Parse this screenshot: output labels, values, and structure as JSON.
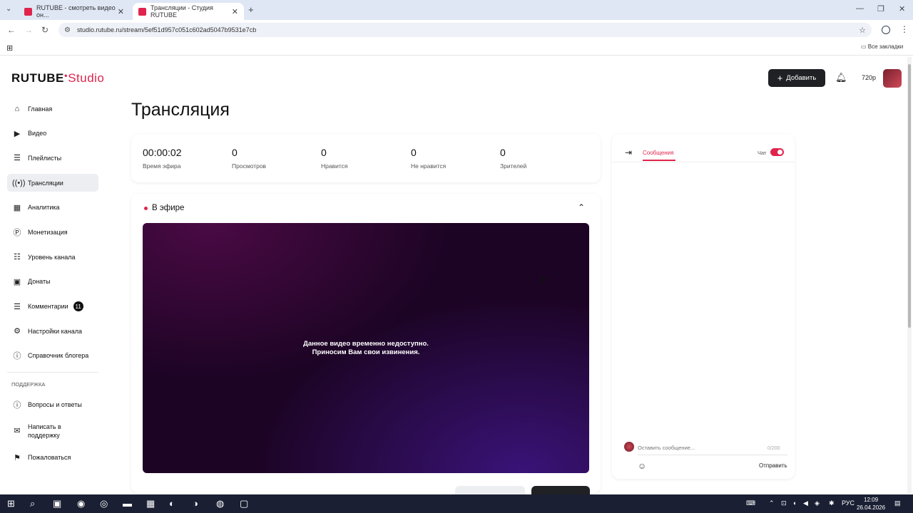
{
  "browser": {
    "tabs": [
      {
        "title": "RUTUBE - смотреть видео он...",
        "active": false
      },
      {
        "title": "Трансляции - Студия RUTUBE",
        "active": true
      }
    ],
    "url": "studio.rutube.ru/stream/5ef51d957c051c602ad5047b9531e7cb",
    "bookmarks_label": "Все закладки"
  },
  "brand": {
    "logo_main": "RUTUBE",
    "logo_sub": "Studio",
    "accent": "#e0244d"
  },
  "sidebar": {
    "items": [
      {
        "label": "Главная",
        "icon": "home-icon"
      },
      {
        "label": "Видео",
        "icon": "video-icon"
      },
      {
        "label": "Плейлисты",
        "icon": "playlist-icon"
      },
      {
        "label": "Трансляции",
        "icon": "broadcast-icon",
        "active": true
      },
      {
        "label": "Аналитика",
        "icon": "analytics-icon"
      },
      {
        "label": "Монетизация",
        "icon": "monetization-icon"
      },
      {
        "label": "Уровень канала",
        "icon": "channel-level-icon"
      },
      {
        "label": "Донаты",
        "icon": "donate-icon"
      },
      {
        "label": "Комментарии",
        "icon": "comments-icon",
        "badge": "11"
      },
      {
        "label": "Настройки канала",
        "icon": "settings-icon"
      },
      {
        "label": "Справочник блогера",
        "icon": "help-book-icon"
      }
    ],
    "support_title": "ПОДДЕРЖКА",
    "support_items": [
      {
        "label": "Вопросы и ответы",
        "icon": "faq-icon"
      },
      {
        "label": "Написать в поддержку",
        "icon": "mail-icon"
      },
      {
        "label": "Пожаловаться",
        "icon": "flag-icon"
      }
    ]
  },
  "header": {
    "add_label": "Добавить",
    "quality": "720p"
  },
  "page": {
    "title": "Трансляция"
  },
  "stats": [
    {
      "value": "00:00:02",
      "label": "Время эфира"
    },
    {
      "value": "0",
      "label": "Просмотров"
    },
    {
      "value": "0",
      "label": "Нравится"
    },
    {
      "value": "0",
      "label": "Не нравится"
    },
    {
      "value": "0",
      "label": "Зрителей"
    }
  ],
  "live": {
    "status": "В эфире",
    "player_message_1": "Данное видео временно недоступно.",
    "player_message_2": "Приносим Вам свои извинения."
  },
  "chat": {
    "tab_messages": "Сообщения",
    "chat_toggle_label": "Чат",
    "input_placeholder": "Оставить сообщение...",
    "counter": "0/200",
    "send_label": "Отправить"
  },
  "taskbar": {
    "time": "12:09",
    "date": "26.04.2026",
    "lang": "РУС"
  }
}
